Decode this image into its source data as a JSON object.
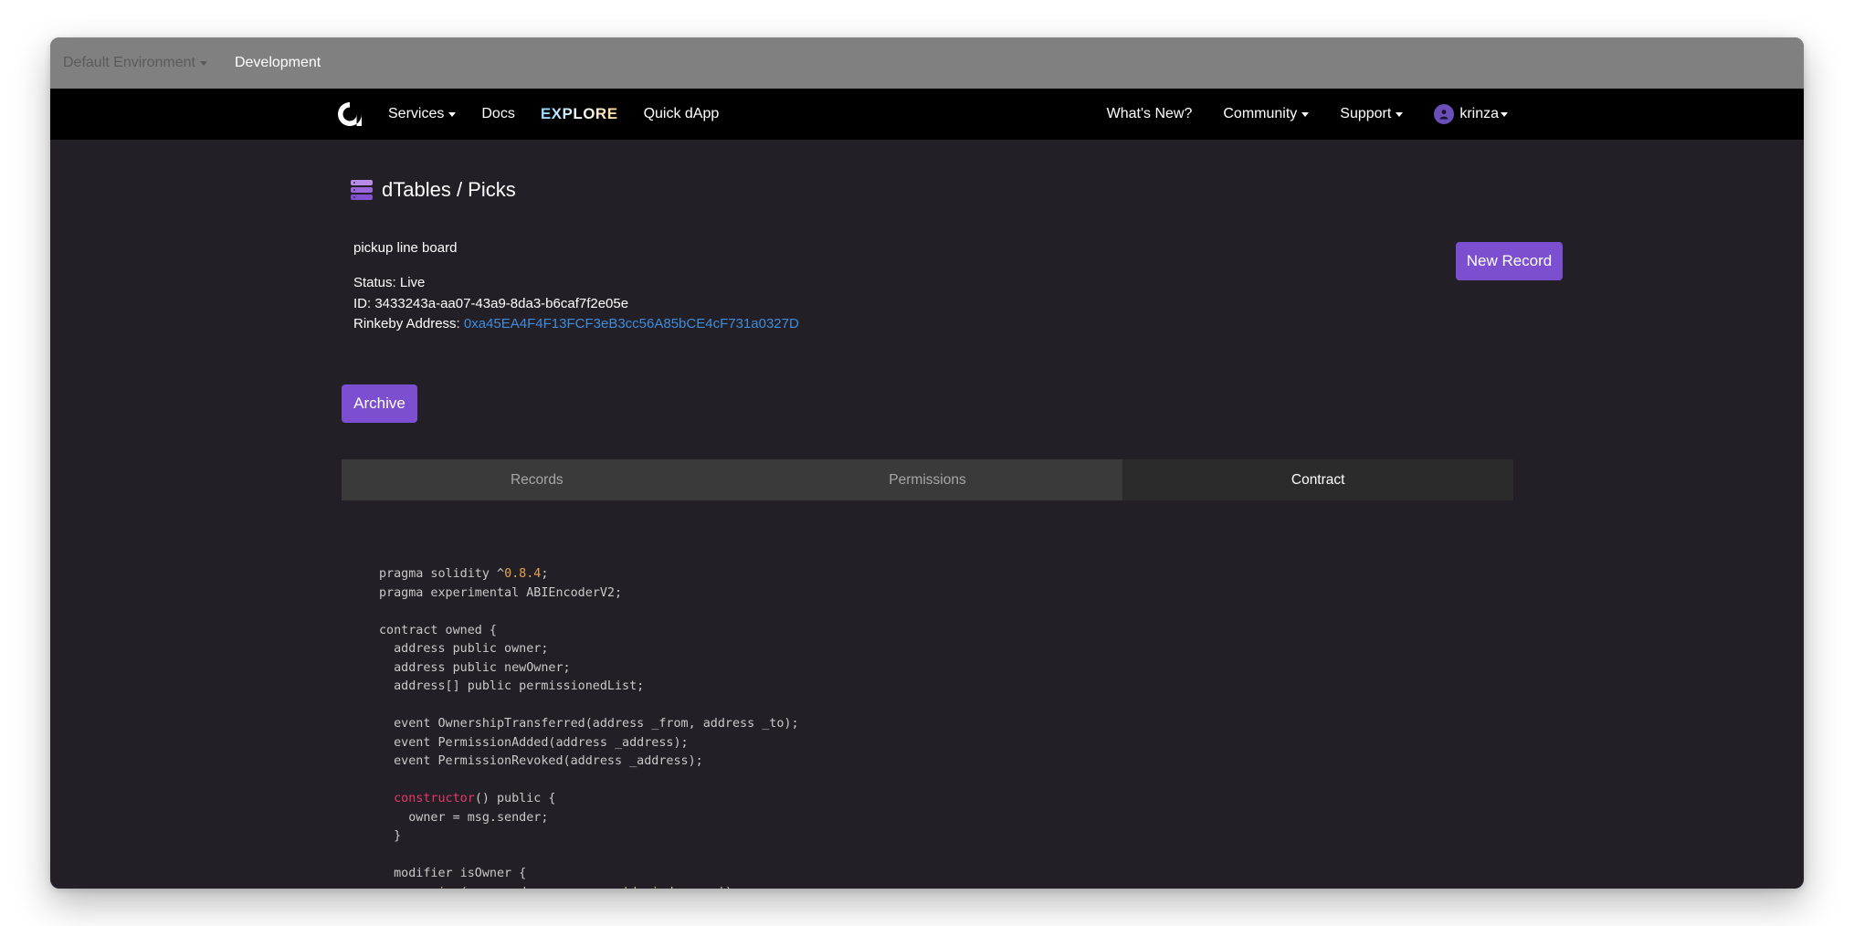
{
  "env_bar": {
    "selector_label": "Default Environment",
    "current": "Development"
  },
  "nav": {
    "left": [
      {
        "label": "Services",
        "dropdown": true
      },
      {
        "label": "Docs",
        "dropdown": false
      },
      {
        "label": "EXPLORE",
        "dropdown": false
      },
      {
        "label": "Quick dApp",
        "dropdown": false
      }
    ],
    "right": {
      "whats_new": "What's New?",
      "community": "Community",
      "support": "Support",
      "user": "krinza"
    }
  },
  "page": {
    "title": "dTables / Picks",
    "description": "pickup line board",
    "status": "Status: Live",
    "id": "ID: 3433243a-aa07-43a9-8da3-b6caf7f2e05e",
    "address_label": "Rinkeby Address: ",
    "address_value": "0xa45EA4F4F13FCF3eB3cc56A85bCE4cF731a0327D",
    "archive_button": "Archive",
    "new_record_button": "New Record"
  },
  "tabs": [
    {
      "label": "Records",
      "active": false
    },
    {
      "label": "Permissions",
      "active": false
    },
    {
      "label": "Contract",
      "active": true
    }
  ],
  "code_lines": [
    [
      {
        "t": "pragma solidity ^"
      },
      {
        "t": "0.8.4",
        "c": "num"
      },
      {
        "t": ";"
      }
    ],
    [
      {
        "t": "pragma experimental ABIEncoderV2;"
      }
    ],
    [],
    [
      {
        "t": "contract owned {"
      }
    ],
    [
      {
        "t": "  address public owner;"
      }
    ],
    [
      {
        "t": "  address public newOwner;"
      }
    ],
    [
      {
        "t": "  address[] public permissionedList;"
      }
    ],
    [],
    [
      {
        "t": "  event OwnershipTransferred(address _from, address _to);"
      }
    ],
    [
      {
        "t": "  event PermissionAdded(address _address);"
      }
    ],
    [
      {
        "t": "  event PermissionRevoked(address _address);"
      }
    ],
    [],
    [
      {
        "t": "  "
      },
      {
        "t": "constructor",
        "c": "kw"
      },
      {
        "t": "() public {"
      }
    ],
    [
      {
        "t": "    owner = msg.sender;"
      }
    ],
    [
      {
        "t": "  }"
      }
    ],
    [],
    [
      {
        "t": "  modifier isOwner {"
      }
    ],
    [
      {
        "t": "    "
      },
      {
        "t": "require",
        "c": "fn"
      },
      {
        "t": "(msg.sender == owner, "
      },
      {
        "t": "'denied-owner'",
        "c": "str"
      },
      {
        "t": ");"
      }
    ],
    [
      {
        "t": "    _;"
      }
    ],
    [
      {
        "t": "  }"
      }
    ]
  ],
  "colors": {
    "accent": "#7b4fd0",
    "link": "#3f8ddc",
    "background": "#221f26",
    "navbar": "#000000",
    "env_bar": "#808080"
  }
}
